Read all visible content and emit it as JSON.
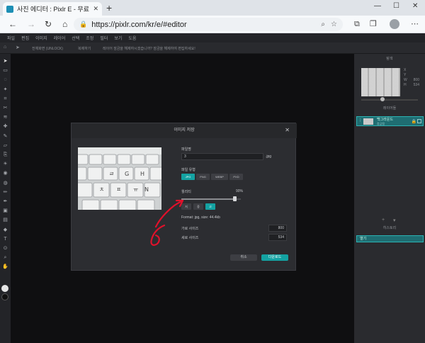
{
  "browser": {
    "tab_title": "사진 에디터 : Pixlr E - 무료 이미지",
    "tab_close": "✕",
    "new_tab": "+",
    "window_controls": [
      "—",
      "☐",
      "✕"
    ],
    "url": "https://pixlr.com/kr/e/#editor",
    "nav": {
      "back": "←",
      "forward": "→",
      "refresh": "↻",
      "home": "⌂"
    },
    "toolbar_icons": [
      "zoom-icon",
      "favorites-add-icon",
      "extensions-icon",
      "favorites-icon",
      "collections-icon",
      "profile-icon",
      "more-icon"
    ]
  },
  "menubar": {
    "items": [
      "파일",
      "편집",
      "이미지",
      "레이어",
      "선택",
      "조정",
      "필터",
      "보기",
      "도움"
    ]
  },
  "toolbar_options": {
    "items": [
      "전체화면 (UNLOCK)",
      "복제하기",
      "레이어 잠금을 해제하시겠습니까? 잠금을 해제하여 편집하세요!"
    ]
  },
  "left_tools": [
    "arrange-icon",
    "marquee-icon",
    "lasso-icon",
    "wand-icon",
    "crop-icon",
    "cutout-icon",
    "liquify-icon",
    "heal-icon",
    "brush-icon",
    "eraser-icon",
    "clone-icon",
    "dodge-icon",
    "blur-icon",
    "sponge-icon",
    "drawing-icon",
    "pen-icon",
    "fill-icon",
    "gradient-icon",
    "shape-icon",
    "text-icon",
    "color-picker-icon",
    "zoom-icon",
    "hand-icon"
  ],
  "right_panel": {
    "navigator_title": "탐색",
    "nav_values": [
      {
        "k": "X",
        "v": ""
      },
      {
        "k": "Y",
        "v": ""
      },
      {
        "k": "W",
        "v": "800"
      },
      {
        "k": "H",
        "v": "534"
      }
    ],
    "layers_title": "레이어들",
    "layer_name": "백그라운드",
    "layer_sub": "잠금됨",
    "history_title": "히스토리",
    "history_item": "열기"
  },
  "save_dialog": {
    "title": "이미지 저장",
    "filename_label": "파일명",
    "filename_value": "3",
    "ext": ".jpg",
    "filetype_label": "파일 유형",
    "filetypes": [
      "JPG",
      "PNG",
      "WEBP",
      "PXD"
    ],
    "selected_type": "JPG",
    "quality_label": "퀄리티",
    "quality_value": "90%",
    "quality_fraction": 0.9,
    "quality_presets": [
      "저",
      "중",
      "고"
    ],
    "format_info": "Format: jpg, size: 44.4kb",
    "width_label": "가로 사이즈",
    "width_value": "800",
    "height_label": "세로 사이즈",
    "height_value": "534",
    "cancel_label": "취소",
    "download_label": "다운로드"
  },
  "annotation": {
    "color": "#e0112b"
  }
}
